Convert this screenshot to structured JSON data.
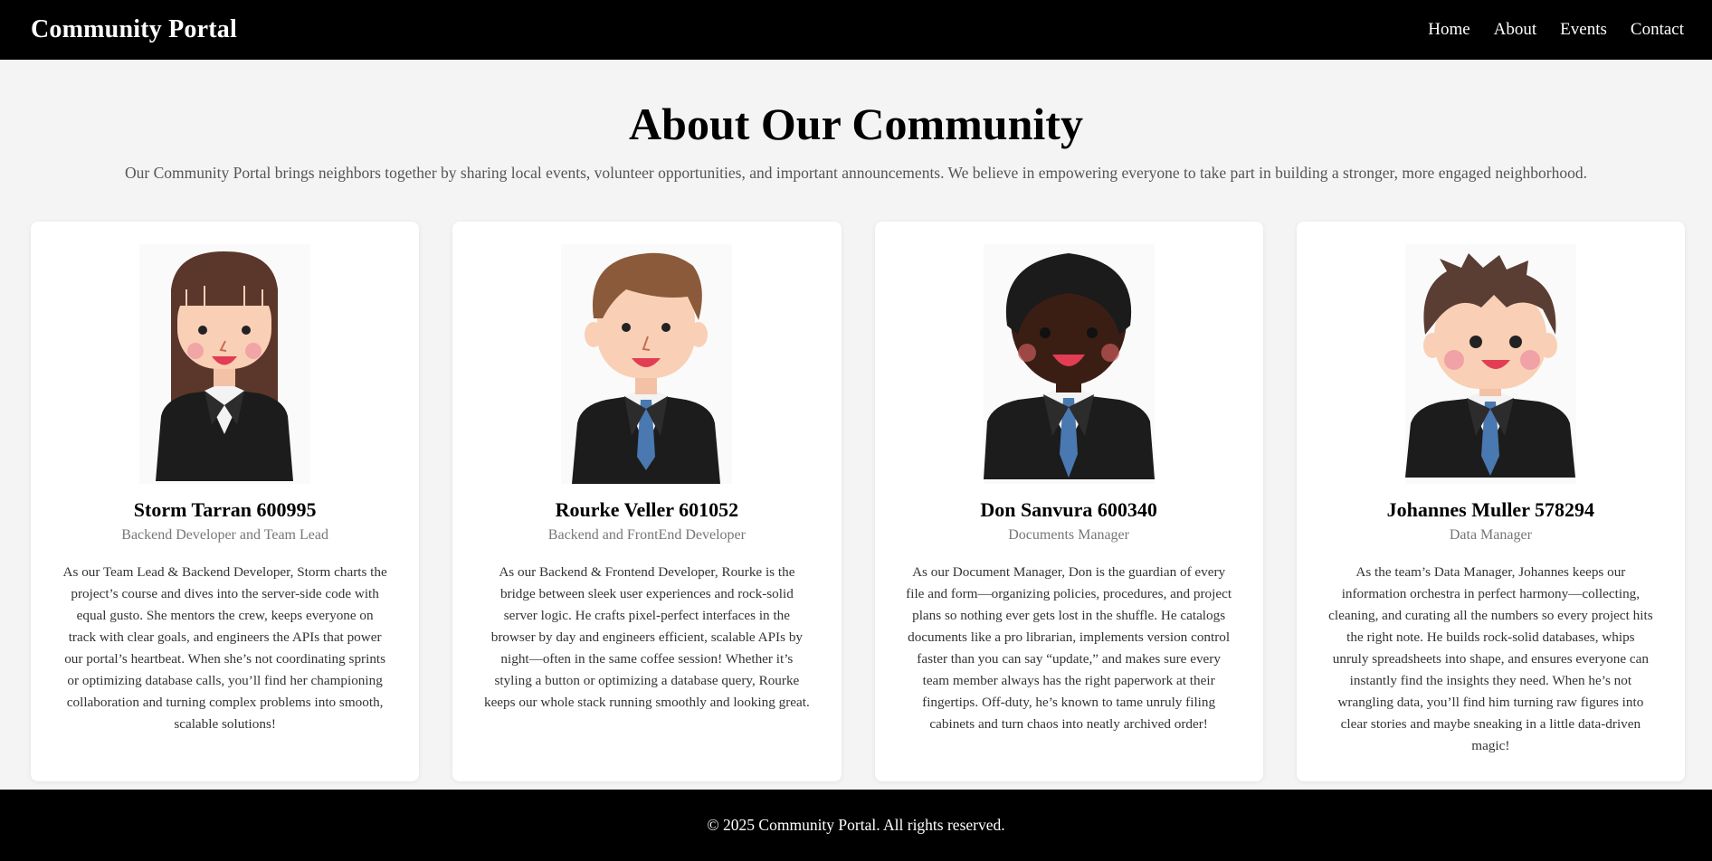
{
  "header": {
    "brand": "Community Portal",
    "nav": [
      {
        "label": "Home"
      },
      {
        "label": "About"
      },
      {
        "label": "Events"
      },
      {
        "label": "Contact"
      }
    ]
  },
  "hero": {
    "title": "About Our Community",
    "description": "Our Community Portal brings neighbors together by sharing local events, volunteer opportunities, and important announcements. We believe in empowering everyone to take part in building a stronger, more engaged neighborhood."
  },
  "members": [
    {
      "name": "Storm Tarran 600995",
      "role": "Backend Developer and Team Lead",
      "bio": "As our Team Lead & Backend Developer, Storm charts the project’s course and dives into the server-side code with equal gusto. She mentors the crew, keeps everyone on track with clear goals, and engineers the APIs that power our portal’s heartbeat. When she’s not coordinating sprints or optimizing database calls, you’ll find her championing collaboration and turning complex problems into smooth, scalable solutions!",
      "avatar_icon": "woman-avatar-icon"
    },
    {
      "name": "Rourke Veller 601052",
      "role": "Backend and FrontEnd Developer",
      "bio": "As our Backend & Frontend Developer, Rourke is the bridge between sleek user experiences and rock-solid server logic. He crafts pixel-perfect interfaces in the browser by day and engineers efficient, scalable APIs by night—often in the same coffee session! Whether it’s styling a button or optimizing a database query, Rourke keeps our whole stack running smoothly and looking great.",
      "avatar_icon": "man-avatar-icon"
    },
    {
      "name": "Don Sanvura 600340",
      "role": "Documents Manager",
      "bio": "As our Document Manager, Don is the guardian of every file and form—organizing policies, procedures, and project plans so nothing ever gets lost in the shuffle. He catalogs documents like a pro librarian, implements version control faster than you can say “update,” and makes sure every team member always has the right paperwork at their fingertips. Off-duty, he’s known to tame unruly filing cabinets and turn chaos into neatly archived order!",
      "avatar_icon": "man-avatar-icon"
    },
    {
      "name": "Johannes Muller 578294",
      "role": "Data Manager",
      "bio": "As the team’s Data Manager, Johannes keeps our information orchestra in perfect harmony—collecting, cleaning, and curating all the numbers so every project hits the right note. He builds rock-solid databases, whips unruly spreadsheets into shape, and ensures everyone can instantly find the insights they need. When he’s not wrangling data, you’ll find him turning raw figures into clear stories and maybe sneaking in a little data-driven magic!",
      "avatar_icon": "boy-avatar-icon"
    }
  ],
  "footer": {
    "text": "© 2025 Community Portal. All rights reserved."
  },
  "colors": {
    "header_bg": "#000000",
    "page_bg": "#f4f4f4",
    "card_bg": "#ffffff",
    "tie": "#4a78b0",
    "suit": "#1c1c1c"
  }
}
